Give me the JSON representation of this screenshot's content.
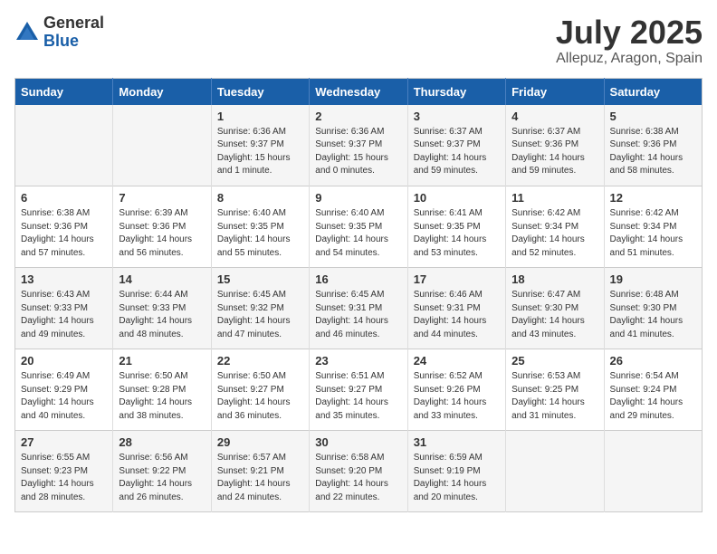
{
  "logo": {
    "general": "General",
    "blue": "Blue"
  },
  "title": {
    "month": "July 2025",
    "location": "Allepuz, Aragon, Spain"
  },
  "headers": [
    "Sunday",
    "Monday",
    "Tuesday",
    "Wednesday",
    "Thursday",
    "Friday",
    "Saturday"
  ],
  "weeks": [
    [
      {
        "day": "",
        "info": ""
      },
      {
        "day": "",
        "info": ""
      },
      {
        "day": "1",
        "info": "Sunrise: 6:36 AM\nSunset: 9:37 PM\nDaylight: 15 hours\nand 1 minute."
      },
      {
        "day": "2",
        "info": "Sunrise: 6:36 AM\nSunset: 9:37 PM\nDaylight: 15 hours\nand 0 minutes."
      },
      {
        "day": "3",
        "info": "Sunrise: 6:37 AM\nSunset: 9:37 PM\nDaylight: 14 hours\nand 59 minutes."
      },
      {
        "day": "4",
        "info": "Sunrise: 6:37 AM\nSunset: 9:36 PM\nDaylight: 14 hours\nand 59 minutes."
      },
      {
        "day": "5",
        "info": "Sunrise: 6:38 AM\nSunset: 9:36 PM\nDaylight: 14 hours\nand 58 minutes."
      }
    ],
    [
      {
        "day": "6",
        "info": "Sunrise: 6:38 AM\nSunset: 9:36 PM\nDaylight: 14 hours\nand 57 minutes."
      },
      {
        "day": "7",
        "info": "Sunrise: 6:39 AM\nSunset: 9:36 PM\nDaylight: 14 hours\nand 56 minutes."
      },
      {
        "day": "8",
        "info": "Sunrise: 6:40 AM\nSunset: 9:35 PM\nDaylight: 14 hours\nand 55 minutes."
      },
      {
        "day": "9",
        "info": "Sunrise: 6:40 AM\nSunset: 9:35 PM\nDaylight: 14 hours\nand 54 minutes."
      },
      {
        "day": "10",
        "info": "Sunrise: 6:41 AM\nSunset: 9:35 PM\nDaylight: 14 hours\nand 53 minutes."
      },
      {
        "day": "11",
        "info": "Sunrise: 6:42 AM\nSunset: 9:34 PM\nDaylight: 14 hours\nand 52 minutes."
      },
      {
        "day": "12",
        "info": "Sunrise: 6:42 AM\nSunset: 9:34 PM\nDaylight: 14 hours\nand 51 minutes."
      }
    ],
    [
      {
        "day": "13",
        "info": "Sunrise: 6:43 AM\nSunset: 9:33 PM\nDaylight: 14 hours\nand 49 minutes."
      },
      {
        "day": "14",
        "info": "Sunrise: 6:44 AM\nSunset: 9:33 PM\nDaylight: 14 hours\nand 48 minutes."
      },
      {
        "day": "15",
        "info": "Sunrise: 6:45 AM\nSunset: 9:32 PM\nDaylight: 14 hours\nand 47 minutes."
      },
      {
        "day": "16",
        "info": "Sunrise: 6:45 AM\nSunset: 9:31 PM\nDaylight: 14 hours\nand 46 minutes."
      },
      {
        "day": "17",
        "info": "Sunrise: 6:46 AM\nSunset: 9:31 PM\nDaylight: 14 hours\nand 44 minutes."
      },
      {
        "day": "18",
        "info": "Sunrise: 6:47 AM\nSunset: 9:30 PM\nDaylight: 14 hours\nand 43 minutes."
      },
      {
        "day": "19",
        "info": "Sunrise: 6:48 AM\nSunset: 9:30 PM\nDaylight: 14 hours\nand 41 minutes."
      }
    ],
    [
      {
        "day": "20",
        "info": "Sunrise: 6:49 AM\nSunset: 9:29 PM\nDaylight: 14 hours\nand 40 minutes."
      },
      {
        "day": "21",
        "info": "Sunrise: 6:50 AM\nSunset: 9:28 PM\nDaylight: 14 hours\nand 38 minutes."
      },
      {
        "day": "22",
        "info": "Sunrise: 6:50 AM\nSunset: 9:27 PM\nDaylight: 14 hours\nand 36 minutes."
      },
      {
        "day": "23",
        "info": "Sunrise: 6:51 AM\nSunset: 9:27 PM\nDaylight: 14 hours\nand 35 minutes."
      },
      {
        "day": "24",
        "info": "Sunrise: 6:52 AM\nSunset: 9:26 PM\nDaylight: 14 hours\nand 33 minutes."
      },
      {
        "day": "25",
        "info": "Sunrise: 6:53 AM\nSunset: 9:25 PM\nDaylight: 14 hours\nand 31 minutes."
      },
      {
        "day": "26",
        "info": "Sunrise: 6:54 AM\nSunset: 9:24 PM\nDaylight: 14 hours\nand 29 minutes."
      }
    ],
    [
      {
        "day": "27",
        "info": "Sunrise: 6:55 AM\nSunset: 9:23 PM\nDaylight: 14 hours\nand 28 minutes."
      },
      {
        "day": "28",
        "info": "Sunrise: 6:56 AM\nSunset: 9:22 PM\nDaylight: 14 hours\nand 26 minutes."
      },
      {
        "day": "29",
        "info": "Sunrise: 6:57 AM\nSunset: 9:21 PM\nDaylight: 14 hours\nand 24 minutes."
      },
      {
        "day": "30",
        "info": "Sunrise: 6:58 AM\nSunset: 9:20 PM\nDaylight: 14 hours\nand 22 minutes."
      },
      {
        "day": "31",
        "info": "Sunrise: 6:59 AM\nSunset: 9:19 PM\nDaylight: 14 hours\nand 20 minutes."
      },
      {
        "day": "",
        "info": ""
      },
      {
        "day": "",
        "info": ""
      }
    ]
  ]
}
